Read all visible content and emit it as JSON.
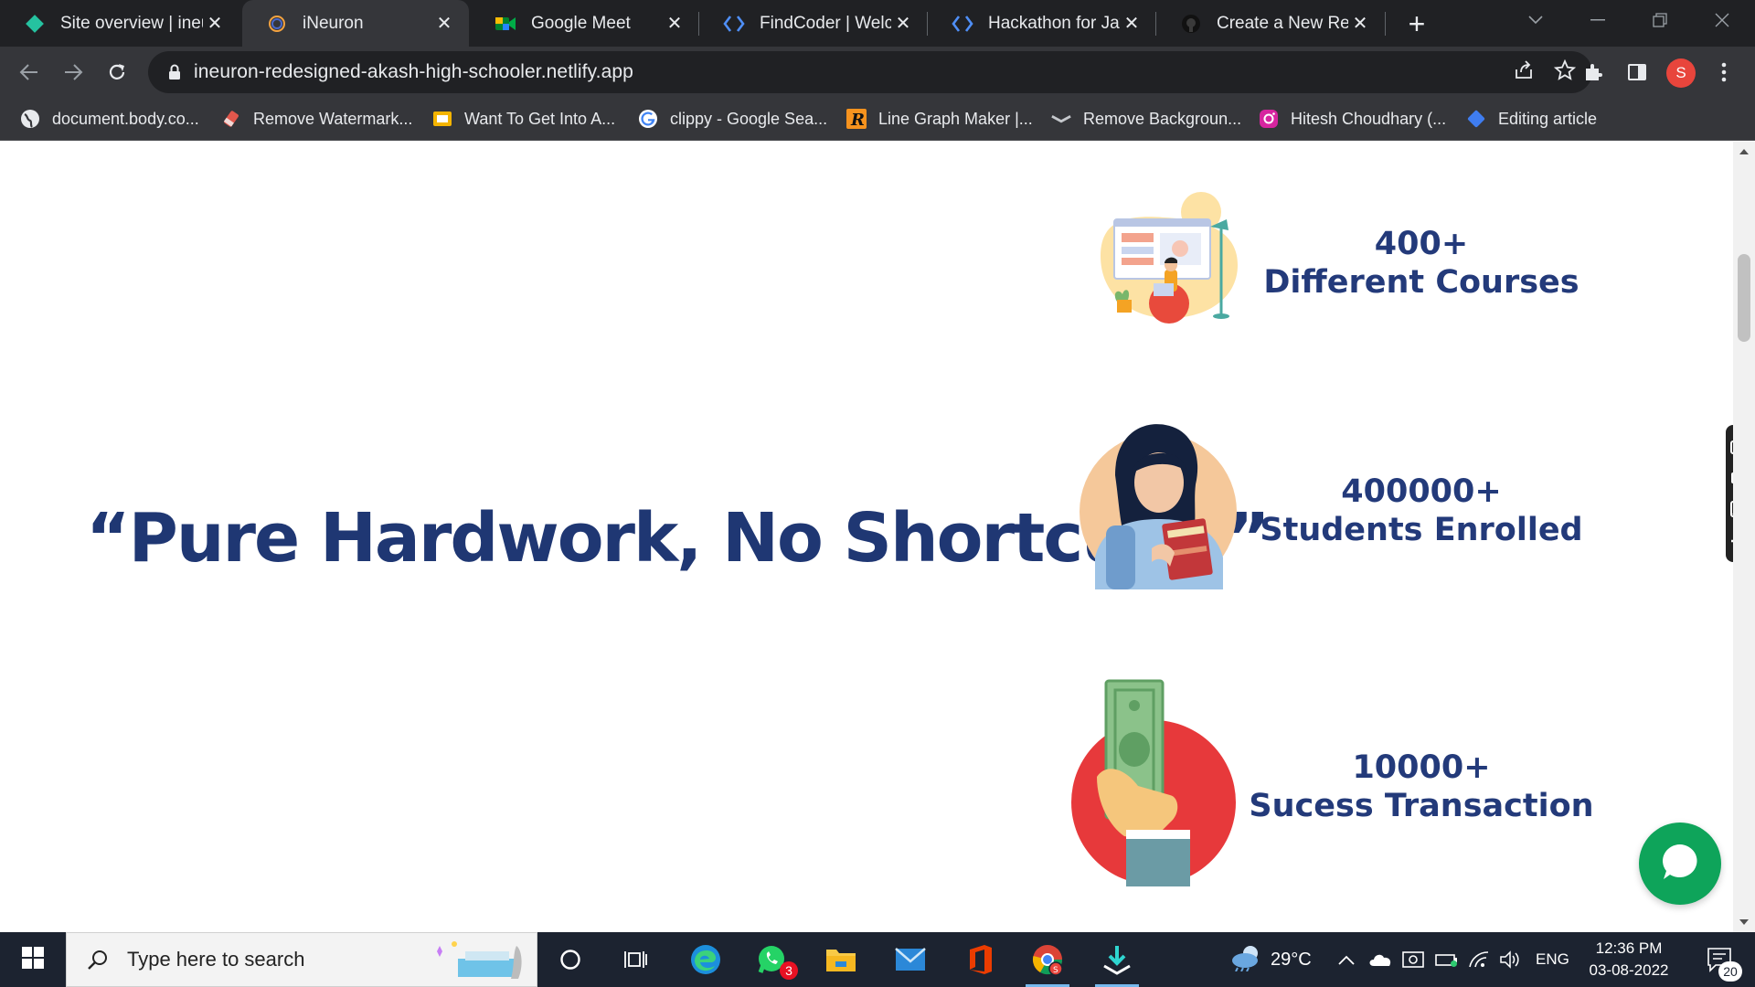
{
  "browser": {
    "tabs": [
      {
        "title": "Site overview | ineu",
        "icon": "netlify-icon",
        "color": "#25c2a0"
      },
      {
        "title": "iNeuron",
        "icon": "ineuron-icon",
        "active": true
      },
      {
        "title": "Google Meet",
        "icon": "google-meet-icon"
      },
      {
        "title": "FindCoder | Welcon",
        "icon": "code-icon"
      },
      {
        "title": "Hackathon for Java",
        "icon": "code-icon"
      },
      {
        "title": "Create a New Repo",
        "icon": "github-icon"
      }
    ],
    "close_glyph": "✕",
    "new_tab_glyph": "+",
    "url": "ineuron-redesigned-akash-high-schooler.netlify.app",
    "profile_initial": "S",
    "bookmarks": [
      {
        "label": "document.body.co...",
        "icon": "globe-icon"
      },
      {
        "label": "Remove Watermark...",
        "icon": "eraser-icon"
      },
      {
        "label": "Want To Get Into A...",
        "icon": "slides-icon"
      },
      {
        "label": "clippy - Google Sea...",
        "icon": "google-icon"
      },
      {
        "label": "Line Graph Maker |...",
        "icon": "r-icon"
      },
      {
        "label": "Remove Backgroun...",
        "icon": "remove-bg-icon"
      },
      {
        "label": "Hitesh Choudhary (...",
        "icon": "instagram-icon"
      },
      {
        "label": "Editing article",
        "icon": "diamond-icon"
      }
    ]
  },
  "page": {
    "quote": "“Pure Hardwork, No Shortcuts!”",
    "stats": [
      {
        "number": "400+",
        "label": "Different Courses",
        "illustration": "person-at-computer-illustration"
      },
      {
        "number": "400000+",
        "label": "Students Enrolled",
        "illustration": "student-with-books-illustration"
      },
      {
        "number": "10000+",
        "label": "Sucess Transaction",
        "illustration": "hand-holding-cash-illustration"
      }
    ],
    "colors": {
      "heading": "#1f3773",
      "chat": "#0ea45a"
    }
  },
  "taskbar": {
    "search_placeholder": "Type here to search",
    "whatsapp_badge": "3",
    "temperature": "29°C",
    "language": "ENG",
    "time": "12:36 PM",
    "date": "03-08-2022",
    "notification_count": "20"
  }
}
